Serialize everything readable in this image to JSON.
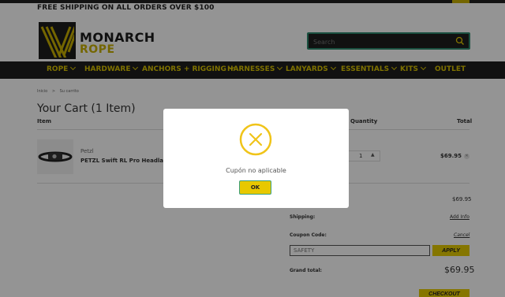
{
  "promo": {
    "text": "FREE SHIPPING ON ALL ORDERS OVER $100"
  },
  "header": {
    "logo_line1": "MONARCH",
    "logo_line2": "ROPE",
    "search_placeholder": "Search"
  },
  "nav": {
    "items": [
      {
        "label": "ROPE",
        "dropdown": true
      },
      {
        "label": "HARDWARE",
        "dropdown": true
      },
      {
        "label": "ANCHORS + RIGGING",
        "dropdown": true
      },
      {
        "label": "HARNESSES",
        "dropdown": true
      },
      {
        "label": "LANYARDS",
        "dropdown": true
      },
      {
        "label": "ESSENTIALS",
        "dropdown": true
      },
      {
        "label": "KITS",
        "dropdown": true
      },
      {
        "label": "OUTLET",
        "dropdown": false
      }
    ]
  },
  "breadcrumb": {
    "home": "Inicio",
    "sep": ">",
    "current": "Su carrito"
  },
  "cart": {
    "title": "Your Cart (1 Item)",
    "columns": {
      "item": "Item",
      "quantity": "Quantity",
      "total": "Total"
    },
    "items": [
      {
        "brand": "Petzl",
        "name": "PETZL Swift RL Pro Headlamp",
        "quantity": "1",
        "price": "$69.95"
      }
    ]
  },
  "summary": {
    "subtotal": "$69.95",
    "shipping_label": "Shipping:",
    "shipping_link": "Add Info",
    "coupon_label": "Coupon Code:",
    "coupon_cancel": "Cancel",
    "coupon_value": "SAFETY",
    "apply_label": "APPLY",
    "grand_label": "Grand total:",
    "grand_value": "$69.95",
    "checkout_label": "CHECKOUT"
  },
  "modal": {
    "message": "Cupón no aplicable",
    "ok_label": "OK",
    "icon": "error-x-icon"
  },
  "colors": {
    "brand_yellow": "#e6cb00",
    "dark": "#1e1e1e",
    "focus_green": "#3aa07e"
  }
}
